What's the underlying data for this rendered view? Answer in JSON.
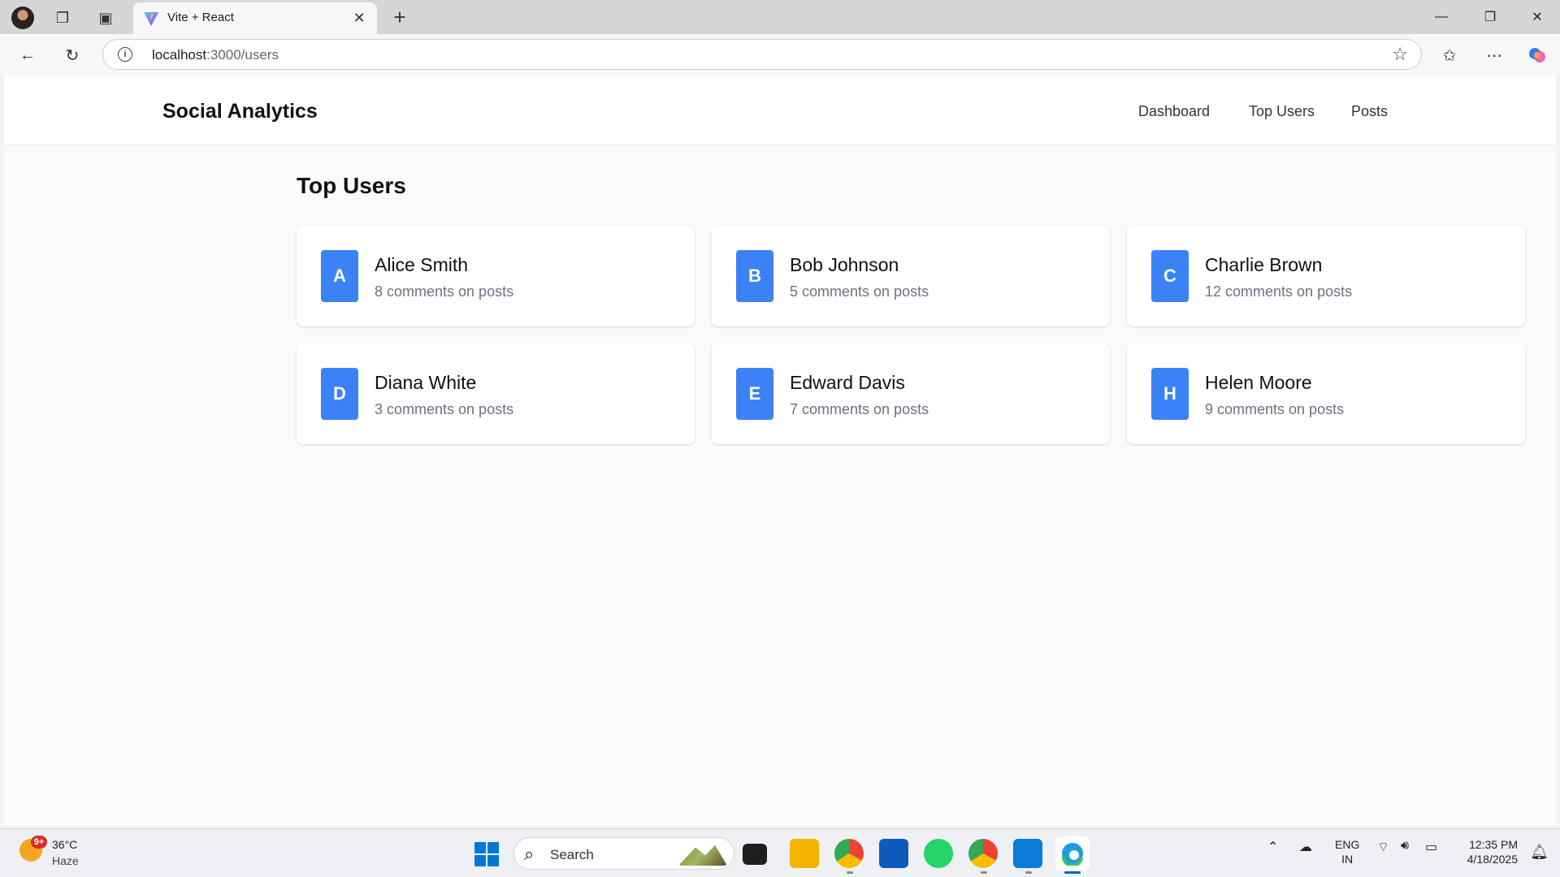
{
  "browser": {
    "tab_title": "Vite + React",
    "url_host": "localhost",
    "url_path": ":3000/users"
  },
  "app": {
    "brand": "Social Analytics",
    "nav": [
      "Dashboard",
      "Top Users",
      "Posts"
    ],
    "page_title": "Top Users",
    "accent_color": "#3b82f6",
    "users": [
      {
        "initial": "A",
        "name": "Alice Smith",
        "comments": "8 comments on posts"
      },
      {
        "initial": "B",
        "name": "Bob Johnson",
        "comments": "5 comments on posts"
      },
      {
        "initial": "C",
        "name": "Charlie Brown",
        "comments": "12 comments on posts"
      },
      {
        "initial": "D",
        "name": "Diana White",
        "comments": "3 comments on posts"
      },
      {
        "initial": "E",
        "name": "Edward Davis",
        "comments": "7 comments on posts"
      },
      {
        "initial": "H",
        "name": "Helen Moore",
        "comments": "9 comments on posts"
      }
    ]
  },
  "taskbar": {
    "weather_badge": "9+",
    "weather_temp": "36°C",
    "weather_cond": "Haze",
    "search_placeholder": "Search",
    "lang_line1": "ENG",
    "lang_line2": "IN",
    "time": "12:35 PM",
    "date": "4/18/2025"
  }
}
